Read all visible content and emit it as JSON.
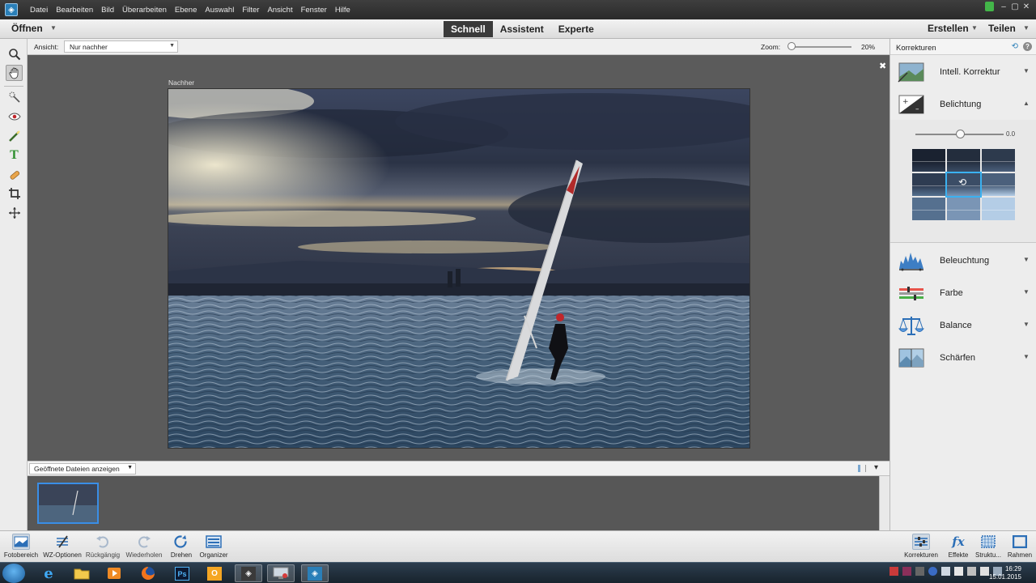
{
  "menubar": {
    "items": [
      "Datei",
      "Bearbeiten",
      "Bild",
      "Überarbeiten",
      "Ebene",
      "Auswahl",
      "Filter",
      "Ansicht",
      "Fenster",
      "Hilfe"
    ]
  },
  "topbar": {
    "open_label": "Öffnen",
    "modes": [
      "Schnell",
      "Assistent",
      "Experte"
    ],
    "active_mode": "Schnell",
    "create_label": "Erstellen",
    "share_label": "Teilen"
  },
  "options": {
    "view_label": "Ansicht:",
    "view_value": "Nur nachher",
    "zoom_label": "Zoom:",
    "zoom_value": "20%",
    "zoom_fraction": 0.03
  },
  "canvas": {
    "after_label": "Nachher",
    "close_glyph": "✖"
  },
  "bin": {
    "select_value": "Geöffnete Dateien anzeigen"
  },
  "panel": {
    "title": "Korrekturen",
    "sections": [
      {
        "label": "Intell. Korrektur",
        "icon": "smart-fix-icon"
      },
      {
        "label": "Belichtung",
        "icon": "exposure-icon"
      },
      {
        "label": "Beleuchtung",
        "icon": "lighting-icon"
      },
      {
        "label": "Farbe",
        "icon": "color-icon"
      },
      {
        "label": "Balance",
        "icon": "balance-icon"
      },
      {
        "label": "Schärfen",
        "icon": "sharpen-icon"
      }
    ],
    "exposure_value": "0.0",
    "exposure_fraction": 0.5
  },
  "bottombar": {
    "left": [
      {
        "label": "Fotobereich",
        "icon": "photo-bin-icon"
      },
      {
        "label": "WZ-Optionen",
        "icon": "tool-options-icon"
      },
      {
        "label": "Rückgängig",
        "icon": "undo-icon"
      },
      {
        "label": "Wiederholen",
        "icon": "redo-icon"
      },
      {
        "label": "Drehen",
        "icon": "rotate-icon"
      },
      {
        "label": "Organizer",
        "icon": "organizer-icon"
      }
    ],
    "right": [
      {
        "label": "Korrekturen",
        "icon": "adjustments-icon"
      },
      {
        "label": "Effekte",
        "icon": "effects-icon"
      },
      {
        "label": "Struktu...",
        "icon": "textures-icon"
      },
      {
        "label": "Rahmen",
        "icon": "frames-icon"
      }
    ]
  },
  "taskbar": {
    "time": "16:29",
    "date": "15.01.2015"
  },
  "colors": {
    "accent": "#3bb1f0",
    "canvas_bg": "#5b5b5b"
  }
}
